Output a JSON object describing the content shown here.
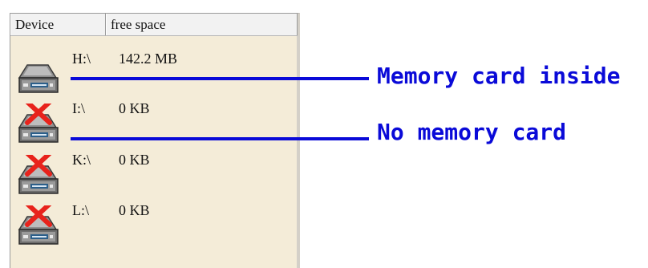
{
  "columns": {
    "device": "Device",
    "free_space": "free space"
  },
  "drives": [
    {
      "letter": "H:\\",
      "free": "142.2 MB",
      "status": "card-present"
    },
    {
      "letter": "I:\\",
      "free": "0 KB",
      "status": "no-card"
    },
    {
      "letter": "K:\\",
      "free": "0 KB",
      "status": "no-card"
    },
    {
      "letter": "L:\\",
      "free": "0 KB",
      "status": "no-card"
    }
  ],
  "annotations": {
    "card_inside": "Memory card inside",
    "no_card": "No memory card"
  },
  "colors": {
    "annotation": "#0a0ad8",
    "panel_bg": "#f4ecd8",
    "x_mark": "#e8231c"
  },
  "icons": {
    "drive": "removable-drive-icon",
    "no_card": "red-x-icon"
  }
}
